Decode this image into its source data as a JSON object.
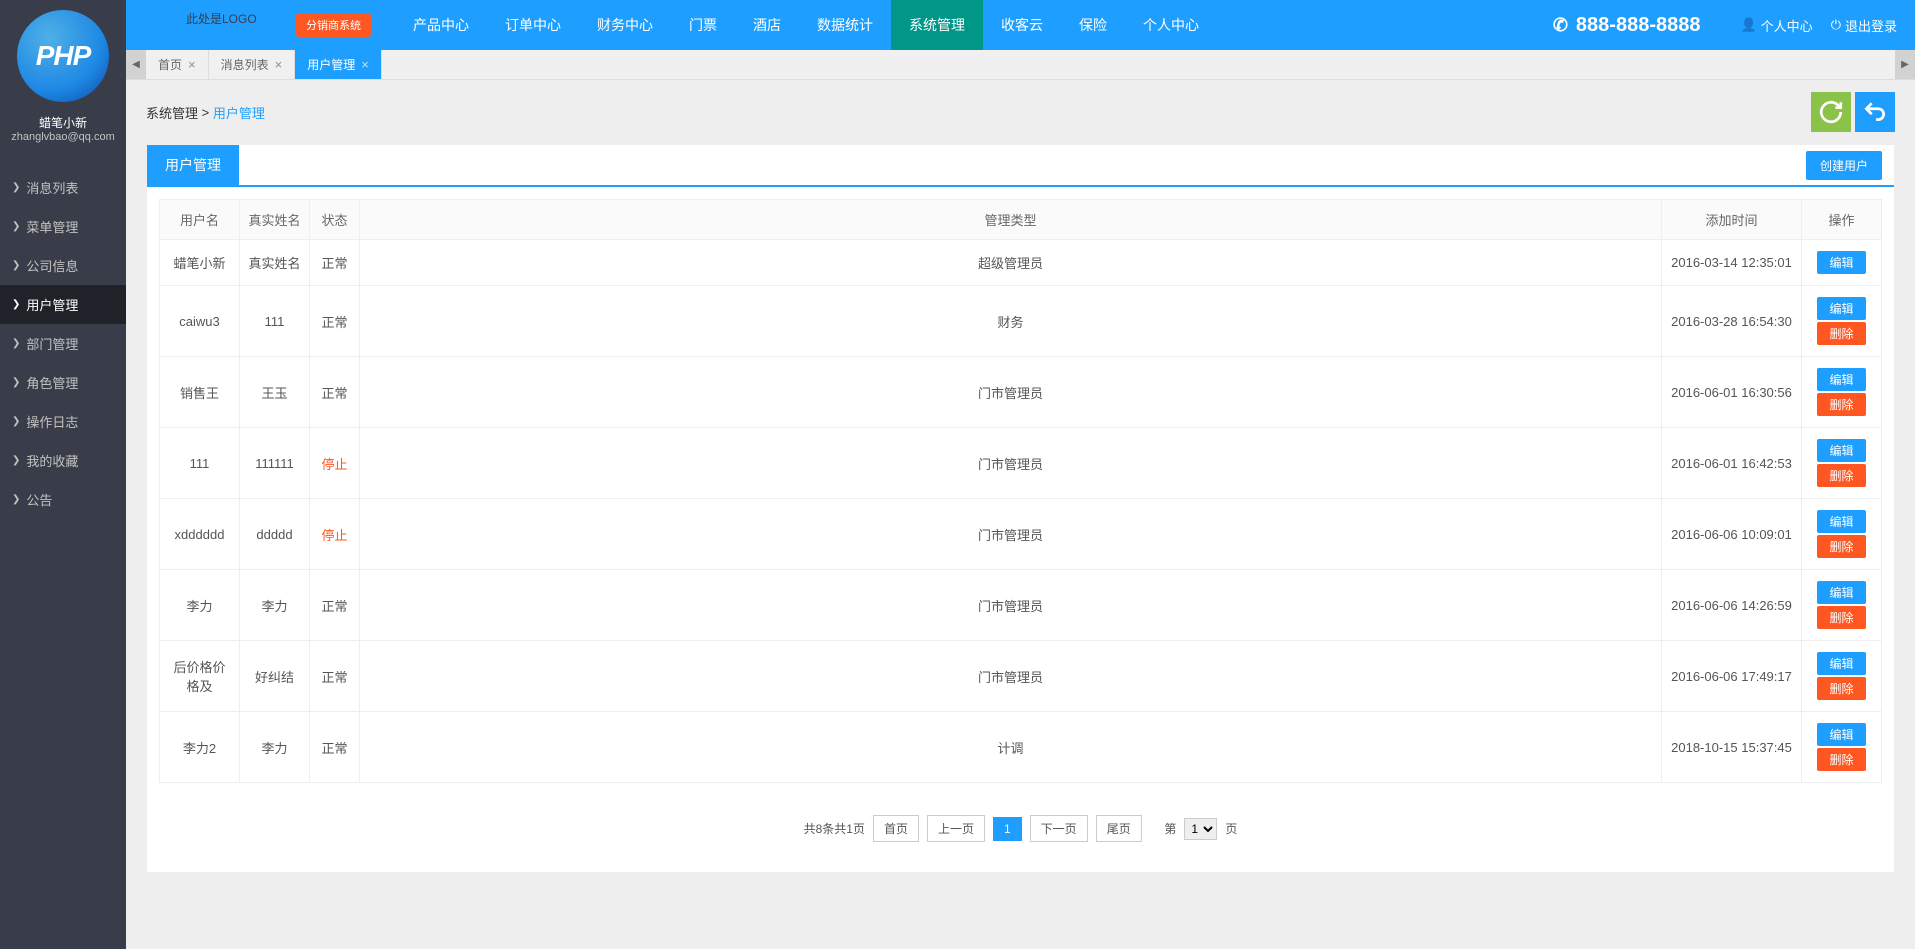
{
  "logo_text": "此处是LOGO",
  "logo_label": "PHP",
  "user": {
    "name": "蜡笔小新",
    "email": "zhanglvbao@qq.com"
  },
  "side_menu": [
    {
      "label": "消息列表",
      "active": false
    },
    {
      "label": "菜单管理",
      "active": false
    },
    {
      "label": "公司信息",
      "active": false
    },
    {
      "label": "用户管理",
      "active": true
    },
    {
      "label": "部门管理",
      "active": false
    },
    {
      "label": "角色管理",
      "active": false
    },
    {
      "label": "操作日志",
      "active": false
    },
    {
      "label": "我的收藏",
      "active": false
    },
    {
      "label": "公告",
      "active": false
    }
  ],
  "dist_badge": "分销商系统",
  "top_nav": [
    {
      "label": "产品中心",
      "active": false
    },
    {
      "label": "订单中心",
      "active": false
    },
    {
      "label": "财务中心",
      "active": false
    },
    {
      "label": "门票",
      "active": false
    },
    {
      "label": "酒店",
      "active": false
    },
    {
      "label": "数据统计",
      "active": false
    },
    {
      "label": "系统管理",
      "active": true
    },
    {
      "label": "收客云",
      "active": false
    },
    {
      "label": "保险",
      "active": false
    },
    {
      "label": "个人中心",
      "active": false
    }
  ],
  "phone": "888-888-8888",
  "top_links": {
    "profile": "个人中心",
    "logout": "退出登录"
  },
  "tabs": [
    {
      "label": "首页",
      "active": false
    },
    {
      "label": "消息列表",
      "active": false
    },
    {
      "label": "用户管理",
      "active": true
    }
  ],
  "breadcrumb": {
    "root": "系统管理",
    "sep": ">",
    "current": "用户管理"
  },
  "panel": {
    "tab": "用户管理",
    "create_btn": "创建用户"
  },
  "columns": {
    "username": "用户名",
    "realname": "真实姓名",
    "status": "状态",
    "type": "管理类型",
    "created": "添加时间",
    "ops": "操作"
  },
  "status_text": {
    "normal": "正常",
    "stop": "停止"
  },
  "op_text": {
    "edit": "编辑",
    "delete": "删除"
  },
  "rows": [
    {
      "username": "蜡笔小新",
      "realname": "真实姓名",
      "status": "normal",
      "type": "超级管理员",
      "created": "2016-03-14 12:35:01",
      "deletable": false
    },
    {
      "username": "caiwu3",
      "realname": "111",
      "status": "normal",
      "type": "财务",
      "created": "2016-03-28 16:54:30",
      "deletable": true
    },
    {
      "username": "销售王",
      "realname": "王玉",
      "status": "normal",
      "type": "门市管理员",
      "created": "2016-06-01 16:30:56",
      "deletable": true
    },
    {
      "username": "111",
      "realname": "111111",
      "status": "stop",
      "type": "门市管理员",
      "created": "2016-06-01 16:42:53",
      "deletable": true
    },
    {
      "username": "xdddddd",
      "realname": "ddddd",
      "status": "stop",
      "type": "门市管理员",
      "created": "2016-06-06 10:09:01",
      "deletable": true
    },
    {
      "username": "李力",
      "realname": "李力",
      "status": "normal",
      "type": "门市管理员",
      "created": "2016-06-06 14:26:59",
      "deletable": true
    },
    {
      "username": "后价格价格及",
      "realname": "好纠结",
      "status": "normal",
      "type": "门市管理员",
      "created": "2016-06-06 17:49:17",
      "deletable": true
    },
    {
      "username": "李力2",
      "realname": "李力",
      "status": "normal",
      "type": "计调",
      "created": "2018-10-15 15:37:45",
      "deletable": true
    }
  ],
  "pagination": {
    "summary": "共8条共1页",
    "first": "首页",
    "prev": "上一页",
    "next": "下一页",
    "last": "尾页",
    "current": "1",
    "jump_prefix": "第",
    "jump_suffix": "页",
    "options": [
      "1"
    ]
  }
}
